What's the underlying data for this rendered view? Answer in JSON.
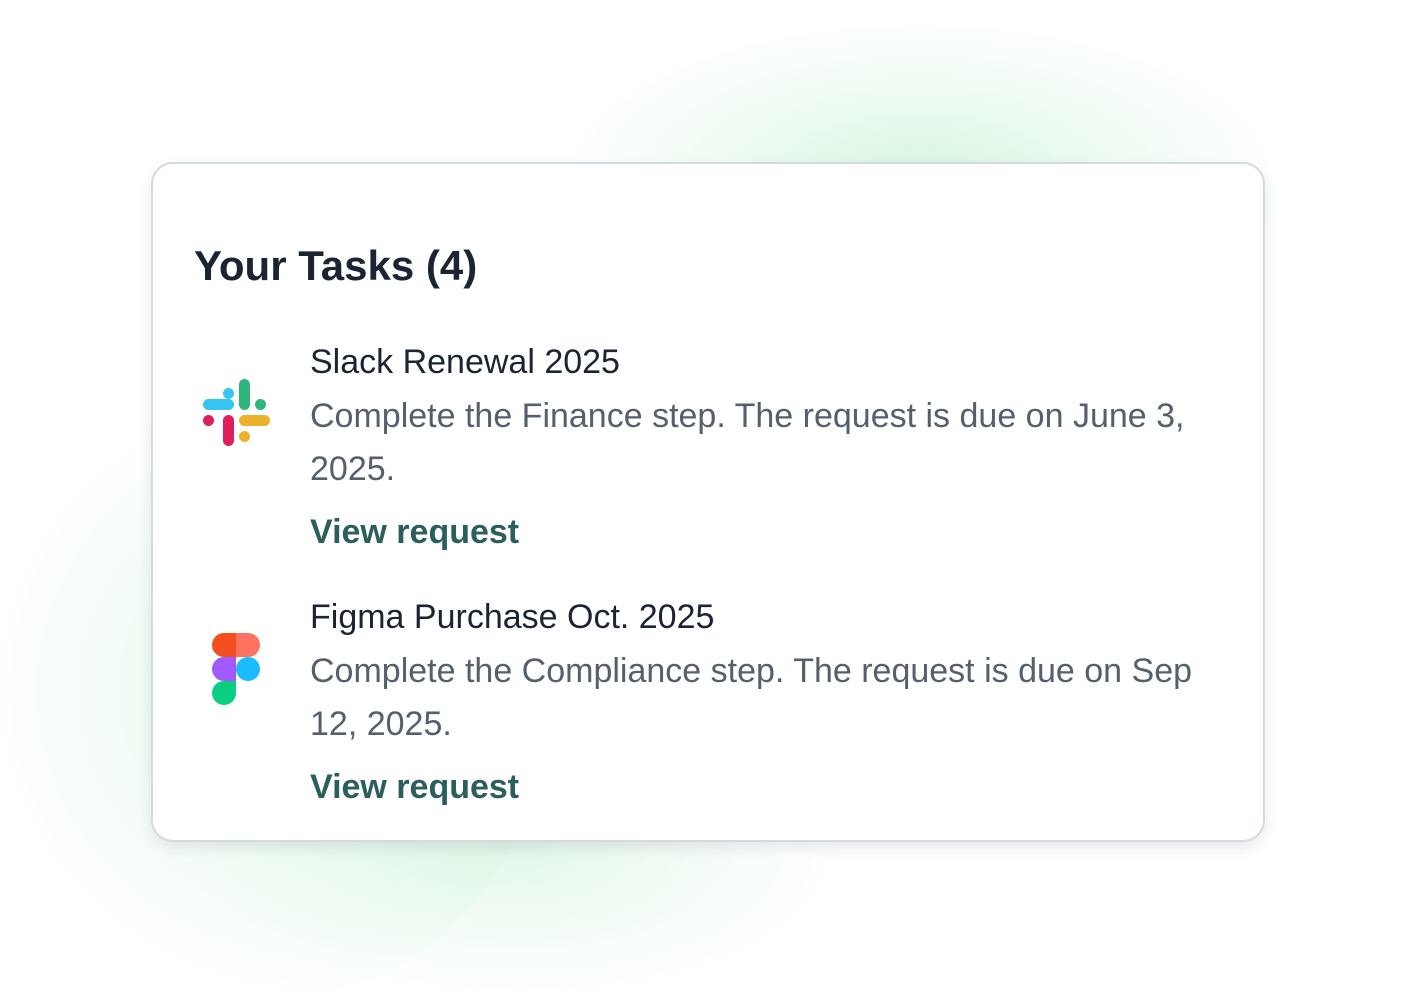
{
  "tasks_panel": {
    "title": "Your Tasks (4)",
    "tasks": [
      {
        "name": "Slack Renewal 2025",
        "description": "Complete the Finance step. The request is due on June 3, 2025.",
        "link_label": "View request",
        "icon": "slack-logo"
      },
      {
        "name": "Figma Purchase Oct. 2025",
        "description": "Complete the Compliance step. The request is due on Sep 12, 2025.",
        "link_label": "View request",
        "icon": "figma-logo"
      }
    ]
  },
  "colors": {
    "title_text": "#1b2432",
    "body_text": "#55606f",
    "link": "#2c5e5c",
    "card_border": "#d3dae2",
    "background_glow": "#b4ecc4"
  }
}
